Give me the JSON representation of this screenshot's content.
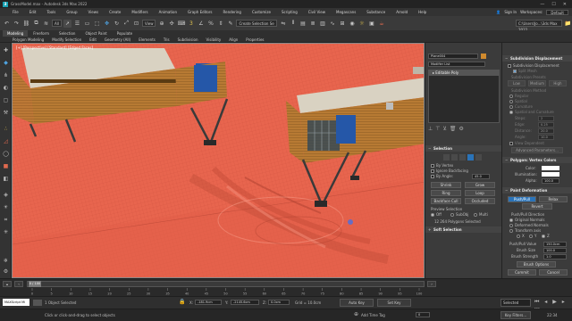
{
  "window": {
    "title": "GrassModel.max - Autodesk 3ds Max 2022",
    "minimize": "—",
    "maximize": "☐",
    "close": "✕"
  },
  "menu": {
    "items": [
      "File",
      "Edit",
      "Tools",
      "Group",
      "Views",
      "Create",
      "Modifiers",
      "Animation",
      "Graph Editors",
      "Rendering",
      "Customize",
      "Scripting",
      "Civil View",
      "Megascans",
      "Substance",
      "Arnold",
      "Help"
    ],
    "signin": "Sign In",
    "workspaces_label": "Workspaces:",
    "workspace": "Default"
  },
  "toolbar": {
    "view_dropdown": "All",
    "coord_dropdown": "View",
    "selection_set": "Create Selection Se",
    "project_path": "C:\\Users\\Jo...\\3ds Max 2022"
  },
  "ribbon": {
    "tabs": [
      "Modeling",
      "Freeform",
      "Selection",
      "Object Paint",
      "Populate"
    ],
    "active_tab": "Modeling",
    "tools": [
      "Polygon Modeling",
      "Modify Selection",
      "Edit",
      "Geometry (All)",
      "Elements",
      "Tris",
      "Subdivision",
      "Visibility",
      "Align",
      "Properties"
    ]
  },
  "viewport": {
    "label": "[+] [Perspective] [Standard] [Edged Faces]"
  },
  "modify": {
    "object_name": "Plane004",
    "modifier_list": "Modifier List",
    "stack_item": "Editable Poly",
    "selection_header": "Selection",
    "by_vertex": "By Vertex",
    "ignore_backfacing": "Ignore Backfacing",
    "by_angle": "By Angle:",
    "by_angle_val": "45.0",
    "shrink": "Shrink",
    "grow": "Grow",
    "ring": "Ring",
    "loop": "Loop",
    "backface_cull": "Backface Cull",
    "occluded": "Occluded",
    "preview_selection": "Preview Selection",
    "off": "Off",
    "subobj": "SubObj",
    "multi": "Multi",
    "selected_count": "12 264 Polygons Selected",
    "soft_selection": "Soft Selection"
  },
  "right": {
    "subdivision_header": "Subdivision Displacement",
    "subdiv_disp": "Subdivision Displacement",
    "split_mesh": "Split Mesh",
    "subdiv_presets": "Subdivision Presets",
    "low": "Low",
    "medium": "Medium",
    "high": "High",
    "subdiv_method": "Subdivision Method",
    "options": [
      "Regular",
      "Spatial",
      "Curvature",
      "Spatial and Curvature"
    ],
    "steps_label": "Steps:",
    "steps": "2",
    "edge_label": "Edge:",
    "edge": "0.25",
    "distance_label": "Distance:",
    "distance": "20.0",
    "angle_label": "Angle:",
    "angle": "10.0",
    "view_dep": "View Dependent",
    "advanced": "Advanced Parameters...",
    "vertex_colors_header": "Polygon: Vertex Colors",
    "color_label": "Color:",
    "illum_label": "Illumination:",
    "alpha_label": "Alpha:",
    "alpha": "100.0",
    "paint_deform_header": "Paint Deformation",
    "push_pull": "Push/Pull",
    "relax": "Relax",
    "revert": "Revert",
    "pp_direction": "Push/Pull Direction",
    "original_normals": "Original Normals",
    "deformed_normals": "Deformed Normals",
    "transform_axis": "Transform axis",
    "x": "X",
    "y": "Y",
    "z": "Z",
    "pp_value_label": "Push/Pull Value",
    "pp_value": "150.0cm",
    "brush_size_label": "Brush Size",
    "brush_size": "100.0",
    "brush_strength_label": "Brush Strength",
    "brush_strength": "1.0",
    "brush_options": "Brush Options",
    "commit": "Commit",
    "cancel": "Cancel"
  },
  "timeline": {
    "frame": "0 / 100",
    "ticks": [
      "0",
      "5",
      "10",
      "15",
      "20",
      "25",
      "30",
      "35",
      "40",
      "45",
      "50",
      "55",
      "60",
      "65",
      "70",
      "75",
      "80",
      "85",
      "90",
      "95",
      "100"
    ]
  },
  "status": {
    "maxscript": "MAXScript Mi",
    "selected": "1 Object Selected",
    "prompt": "Click or click-and-drag to select objects",
    "x_label": "X:",
    "x": "-181.9cm",
    "y_label": "Y:",
    "y": "-2145.6cm",
    "z_label": "Z:",
    "z": "0.0cm",
    "grid": "Grid = 10.0cm",
    "add_time_tag": "Add Time Tag",
    "auto_key": "Auto Key",
    "set_key": "Set Key",
    "selected_dd": "Selected",
    "key_filters": "Key Filters...",
    "frame": "0"
  },
  "taskbar": {
    "time": "22:34"
  },
  "colors": {
    "viewport_bg": "#e8654e",
    "accent_blue": "#2a73b8",
    "house_wood": "#c98a3a",
    "window_blue": "#2557a8"
  }
}
